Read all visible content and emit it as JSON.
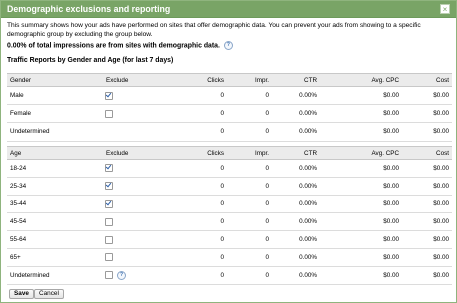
{
  "dialog": {
    "title": "Demographic exclusions and reporting",
    "close_glyph": "×",
    "description": "This summary shows how your ads have performed on sites that offer demographic data. You can prevent your ads from showing to a specific demographic group by excluding the group below.",
    "impression_share": "0.00% of total impressions are from sites with demographic data.",
    "help_glyph": "?",
    "section_title": "Traffic Reports by Gender and Age (for last 7 days)",
    "save_label": "Save",
    "cancel_label": "Cancel"
  },
  "columns": [
    "Exclude",
    "Clicks",
    "Impr.",
    "CTR",
    "Avg. CPC",
    "Cost"
  ],
  "gender": {
    "header": "Gender",
    "rows": [
      {
        "label": "Male",
        "excluded": true,
        "clicks": "0",
        "impr": "0",
        "ctr": "0.00%",
        "cpc": "$0.00",
        "cost": "$0.00"
      },
      {
        "label": "Female",
        "excluded": false,
        "clicks": "0",
        "impr": "0",
        "ctr": "0.00%",
        "cpc": "$0.00",
        "cost": "$0.00"
      },
      {
        "label": "Undetermined",
        "excluded": null,
        "clicks": "0",
        "impr": "0",
        "ctr": "0.00%",
        "cpc": "$0.00",
        "cost": "$0.00"
      }
    ]
  },
  "age": {
    "header": "Age",
    "rows": [
      {
        "label": "18-24",
        "excluded": true,
        "clicks": "0",
        "impr": "0",
        "ctr": "0.00%",
        "cpc": "$0.00",
        "cost": "$0.00"
      },
      {
        "label": "25-34",
        "excluded": true,
        "clicks": "0",
        "impr": "0",
        "ctr": "0.00%",
        "cpc": "$0.00",
        "cost": "$0.00"
      },
      {
        "label": "35-44",
        "excluded": true,
        "clicks": "0",
        "impr": "0",
        "ctr": "0.00%",
        "cpc": "$0.00",
        "cost": "$0.00"
      },
      {
        "label": "45-54",
        "excluded": false,
        "clicks": "0",
        "impr": "0",
        "ctr": "0.00%",
        "cpc": "$0.00",
        "cost": "$0.00"
      },
      {
        "label": "55-64",
        "excluded": false,
        "clicks": "0",
        "impr": "0",
        "ctr": "0.00%",
        "cpc": "$0.00",
        "cost": "$0.00"
      },
      {
        "label": "65+",
        "excluded": false,
        "clicks": "0",
        "impr": "0",
        "ctr": "0.00%",
        "cpc": "$0.00",
        "cost": "$0.00"
      },
      {
        "label": "Undetermined",
        "excluded": false,
        "help": true,
        "clicks": "0",
        "impr": "0",
        "ctr": "0.00%",
        "cpc": "$0.00",
        "cost": "$0.00"
      }
    ]
  },
  "colors": {
    "title_bar": "#79a466",
    "header_row": "#ebebeb",
    "checkmark": "#2d5fa8"
  },
  "icons": {
    "close": "close-icon",
    "help": "help-icon",
    "checkbox": "checkbox-icon"
  }
}
